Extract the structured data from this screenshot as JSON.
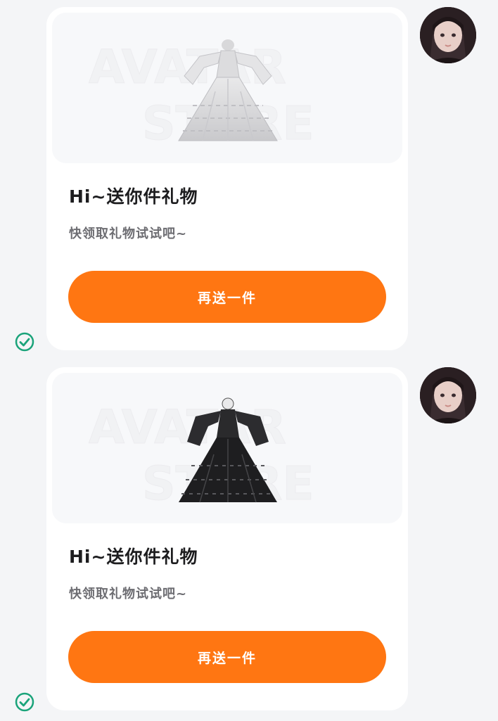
{
  "messages": [
    {
      "watermark_line1": "AVATAR",
      "watermark_line2": "STORE",
      "gift_image_icon": "white-gown-icon",
      "title": "Hi~送你件礼物",
      "subtitle": "快领取礼物试试吧~",
      "button_label": "再送一件",
      "status": "sent-check-icon"
    },
    {
      "watermark_line1": "AVATAR",
      "watermark_line2": "STORE",
      "gift_image_icon": "black-gown-icon",
      "title": "Hi~送你件礼物",
      "subtitle": "快领取礼物试试吧~",
      "button_label": "再送一件",
      "status": "sent-check-icon"
    }
  ],
  "colors": {
    "accent": "#ff7612",
    "status_check": "#1aa37a",
    "card_bg": "#ffffff",
    "page_bg": "#f4f5f7"
  }
}
